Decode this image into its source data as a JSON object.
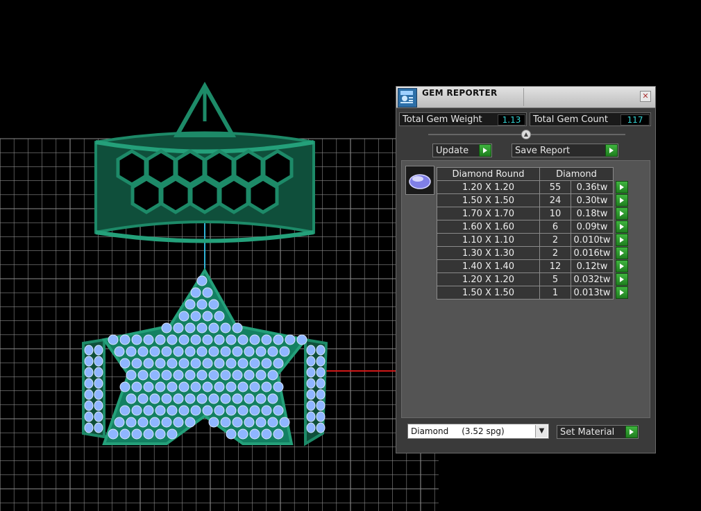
{
  "window": {
    "title": "GEM REPORTER",
    "close_glyph": "✕"
  },
  "stats": {
    "weight_label": "Total Gem Weight",
    "weight_value": "1.13",
    "count_label": "Total Gem Count",
    "count_value": "117"
  },
  "splitter_glyph": "▲",
  "actions": {
    "update_label": "Update",
    "save_label": "Save Report"
  },
  "table": {
    "header_cut": "Diamond Round",
    "header_material": "Diamond",
    "rows": [
      {
        "size": "1.20 X 1.20",
        "count": "55",
        "weight": "0.36tw"
      },
      {
        "size": "1.50 X 1.50",
        "count": "24",
        "weight": "0.30tw"
      },
      {
        "size": "1.70 X 1.70",
        "count": "10",
        "weight": "0.18tw"
      },
      {
        "size": "1.60 X 1.60",
        "count": "6",
        "weight": "0.09tw"
      },
      {
        "size": "1.10 X 1.10",
        "count": "2",
        "weight": "0.010tw"
      },
      {
        "size": "1.30 X 1.30",
        "count": "2",
        "weight": "0.016tw"
      },
      {
        "size": "1.40 X 1.40",
        "count": "12",
        "weight": "0.12tw"
      },
      {
        "size": "1.20 X 1.20",
        "count": "5",
        "weight": "0.032tw"
      },
      {
        "size": "1.50 X 1.50",
        "count": "1",
        "weight": "0.013tw"
      }
    ]
  },
  "material": {
    "selected": "Diamond     (3.52 spg)",
    "dropdown_glyph": "▼",
    "set_label": "Set Material"
  },
  "icons": [
    "gem-reporter-app-icon",
    "close-icon",
    "splitter-knob-icon",
    "play-icon",
    "gem-thumbnail-icon",
    "dropdown-arrow-icon"
  ],
  "colors": {
    "viewport_bg": "#000000",
    "grid": "#8c8c8c",
    "ring_green": "#1d8a68",
    "gem_blue": "#8fb6ff",
    "value_cyan": "#34d4d4",
    "button_green": "#2e9a2e",
    "axis_red": "#d01818",
    "axis_cyan": "#2fb3d6"
  }
}
